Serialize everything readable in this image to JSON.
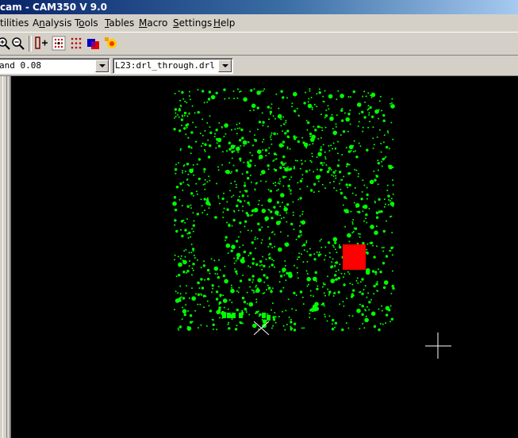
{
  "window": {
    "title": "cam - CAM350 V 9.0"
  },
  "menu": {
    "items": [
      {
        "key": "utilities",
        "pre": "",
        "ul": "",
        "post": "tilities"
      },
      {
        "key": "analysis",
        "pre": "A",
        "ul": "n",
        "post": "alysis"
      },
      {
        "key": "tools",
        "pre": "T",
        "ul": "o",
        "post": "ols"
      },
      {
        "key": "tables",
        "pre": "",
        "ul": "T",
        "post": "ables"
      },
      {
        "key": "macro",
        "pre": "",
        "ul": "M",
        "post": "acro"
      },
      {
        "key": "settings",
        "pre": "",
        "ul": "S",
        "post": "ettings"
      },
      {
        "key": "help",
        "pre": "",
        "ul": "H",
        "post": "elp"
      }
    ]
  },
  "toolbar": {
    "icons": [
      "zoom-in-icon",
      "zoom-out-icon",
      "add-drill-icon",
      "drill-grid-icon",
      "drill-grid-red-icon",
      "layer-colors-icon",
      "highlight-icon"
    ]
  },
  "combos": {
    "aperture_value": "and 0.08",
    "layer_value": "L23:drl_through.drl"
  },
  "canvas": {
    "background": "#000000",
    "pad_color": "#00ff00",
    "highlight_color": "#ff0000",
    "cursor_color": "#ffffff",
    "origin_marker": "x-marker-icon",
    "cursor": "crosshair-cursor-icon"
  }
}
